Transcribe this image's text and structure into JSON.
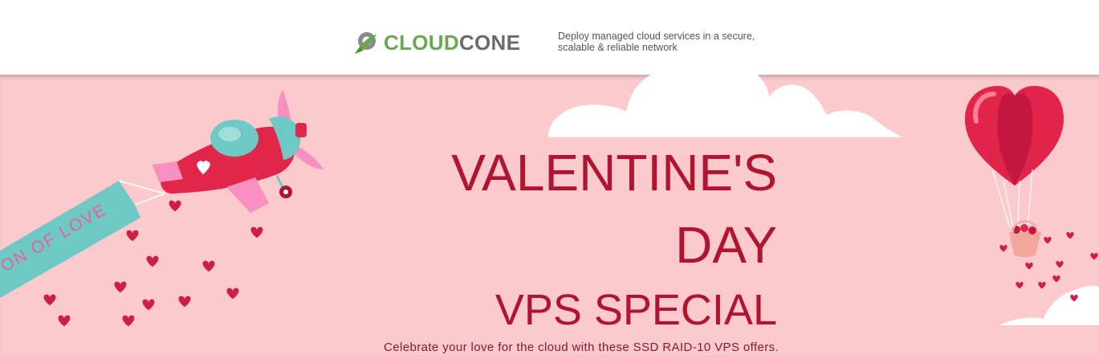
{
  "header": {
    "logo": {
      "part1": "CLOUD",
      "part2": "CONE"
    },
    "tagline": "Deploy managed cloud services in a secure, scalable & reliable network"
  },
  "hero": {
    "banner_text": "ON OF LOVE",
    "title_line1": "VALENTINE'S",
    "title_line2": "DAY",
    "title_line3": "VPS SPECIAL",
    "subtitle": "Celebrate your love for the cloud with these SSD RAID-10 VPS offers."
  },
  "colors": {
    "background": "#fcc9cd",
    "accent": "#b0142e",
    "brand_green": "#6aa84f",
    "brand_gray": "#6b6b6b"
  },
  "icons": [
    "cloudcone-logo-icon",
    "airplane-icon",
    "heart-balloon-icon",
    "cloud-icon",
    "heart-icon"
  ]
}
